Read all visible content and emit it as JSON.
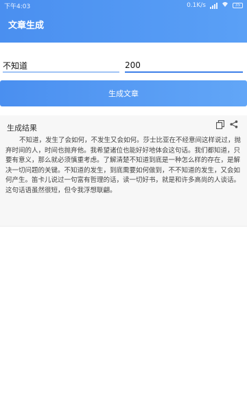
{
  "status_bar": {
    "time": "下午4:03",
    "speed": "0.1K/s",
    "battery": "35"
  },
  "app_bar": {
    "title": "文章生成"
  },
  "inputs": {
    "keyword_value": "不知道",
    "length_value": "200"
  },
  "generate_button": {
    "label": "生成文章"
  },
  "result": {
    "label": "生成结果",
    "copy_icon": "copy-icon",
    "share_icon": "share-icon",
    "text": "不知道，发生了会如何，不发生又会如何。莎士比亚在不经意间这样说过，抛弃时间的人，时间也抛弃他。我希望诸位也能好好地体会这句话。我们都知道，只要有意义，那么就必须慎重考虑。了解清楚不知道到底是一种怎么样的存在，是解决一切问题的关键。不知道的发生，到底需要如何做到，不不知道的发生，又会如何产生。笛卡儿说过一句富有哲理的话，读一切好书，就是和许多高尚的人谈话。这句话语虽然很短，但令我浮想联翩。"
  },
  "colors": {
    "primary": "#4a8ff0",
    "accent_underline": "#3d7fe8",
    "card_bg": "#f7f7f7"
  }
}
